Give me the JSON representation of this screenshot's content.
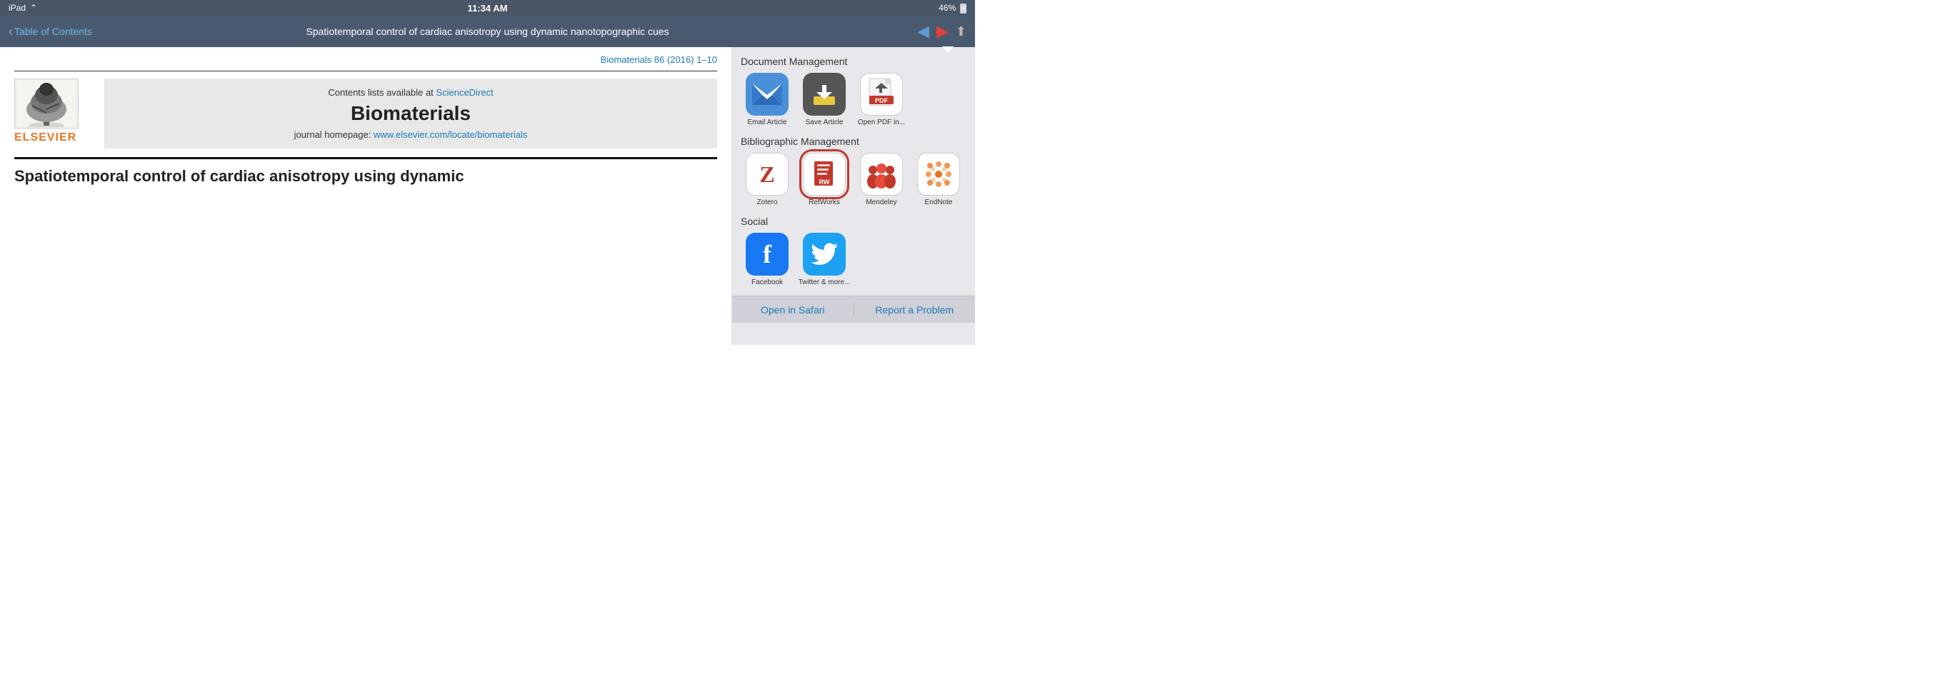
{
  "statusBar": {
    "device": "iPad",
    "wifi": "WiFi",
    "time": "11:34 AM",
    "battery": "46%"
  },
  "navBar": {
    "back_label": "Table of Contents",
    "title": "Spatiotemporal control of cardiac anisotropy using dynamic nanotopographic cues"
  },
  "article": {
    "citation": "Biomaterials 86 (2016) 1–10",
    "contents_text": "Contents lists available at",
    "sciencedirect_link": "ScienceDirect",
    "journal_name": "Biomaterials",
    "homepage_label": "journal homepage:",
    "homepage_link": "www.elsevier.com/locate/biomaterials",
    "elsevier_text": "ELSEVIER",
    "paper_title": "Spatiotemporal control of cardiac anisotropy using dynamic"
  },
  "rightPanel": {
    "docManagement_title": "Document Management",
    "bibManagement_title": "Bibliographic Management",
    "social_title": "Social",
    "docItems": [
      {
        "id": "email",
        "label": "Email Article"
      },
      {
        "id": "save",
        "label": "Save Article"
      },
      {
        "id": "pdf",
        "label": "Open PDF in..."
      }
    ],
    "bibItems": [
      {
        "id": "zotero",
        "label": "Zotero"
      },
      {
        "id": "refworks",
        "label": "RefWorks"
      },
      {
        "id": "mendeley",
        "label": "Mendeley"
      },
      {
        "id": "endnote",
        "label": "EndNote"
      }
    ],
    "socialItems": [
      {
        "id": "facebook",
        "label": "Facebook"
      },
      {
        "id": "twitter",
        "label": "Twitter & more..."
      }
    ]
  },
  "bottomBar": {
    "open_safari": "Open in Safari",
    "report_problem": "Report a Problem"
  }
}
